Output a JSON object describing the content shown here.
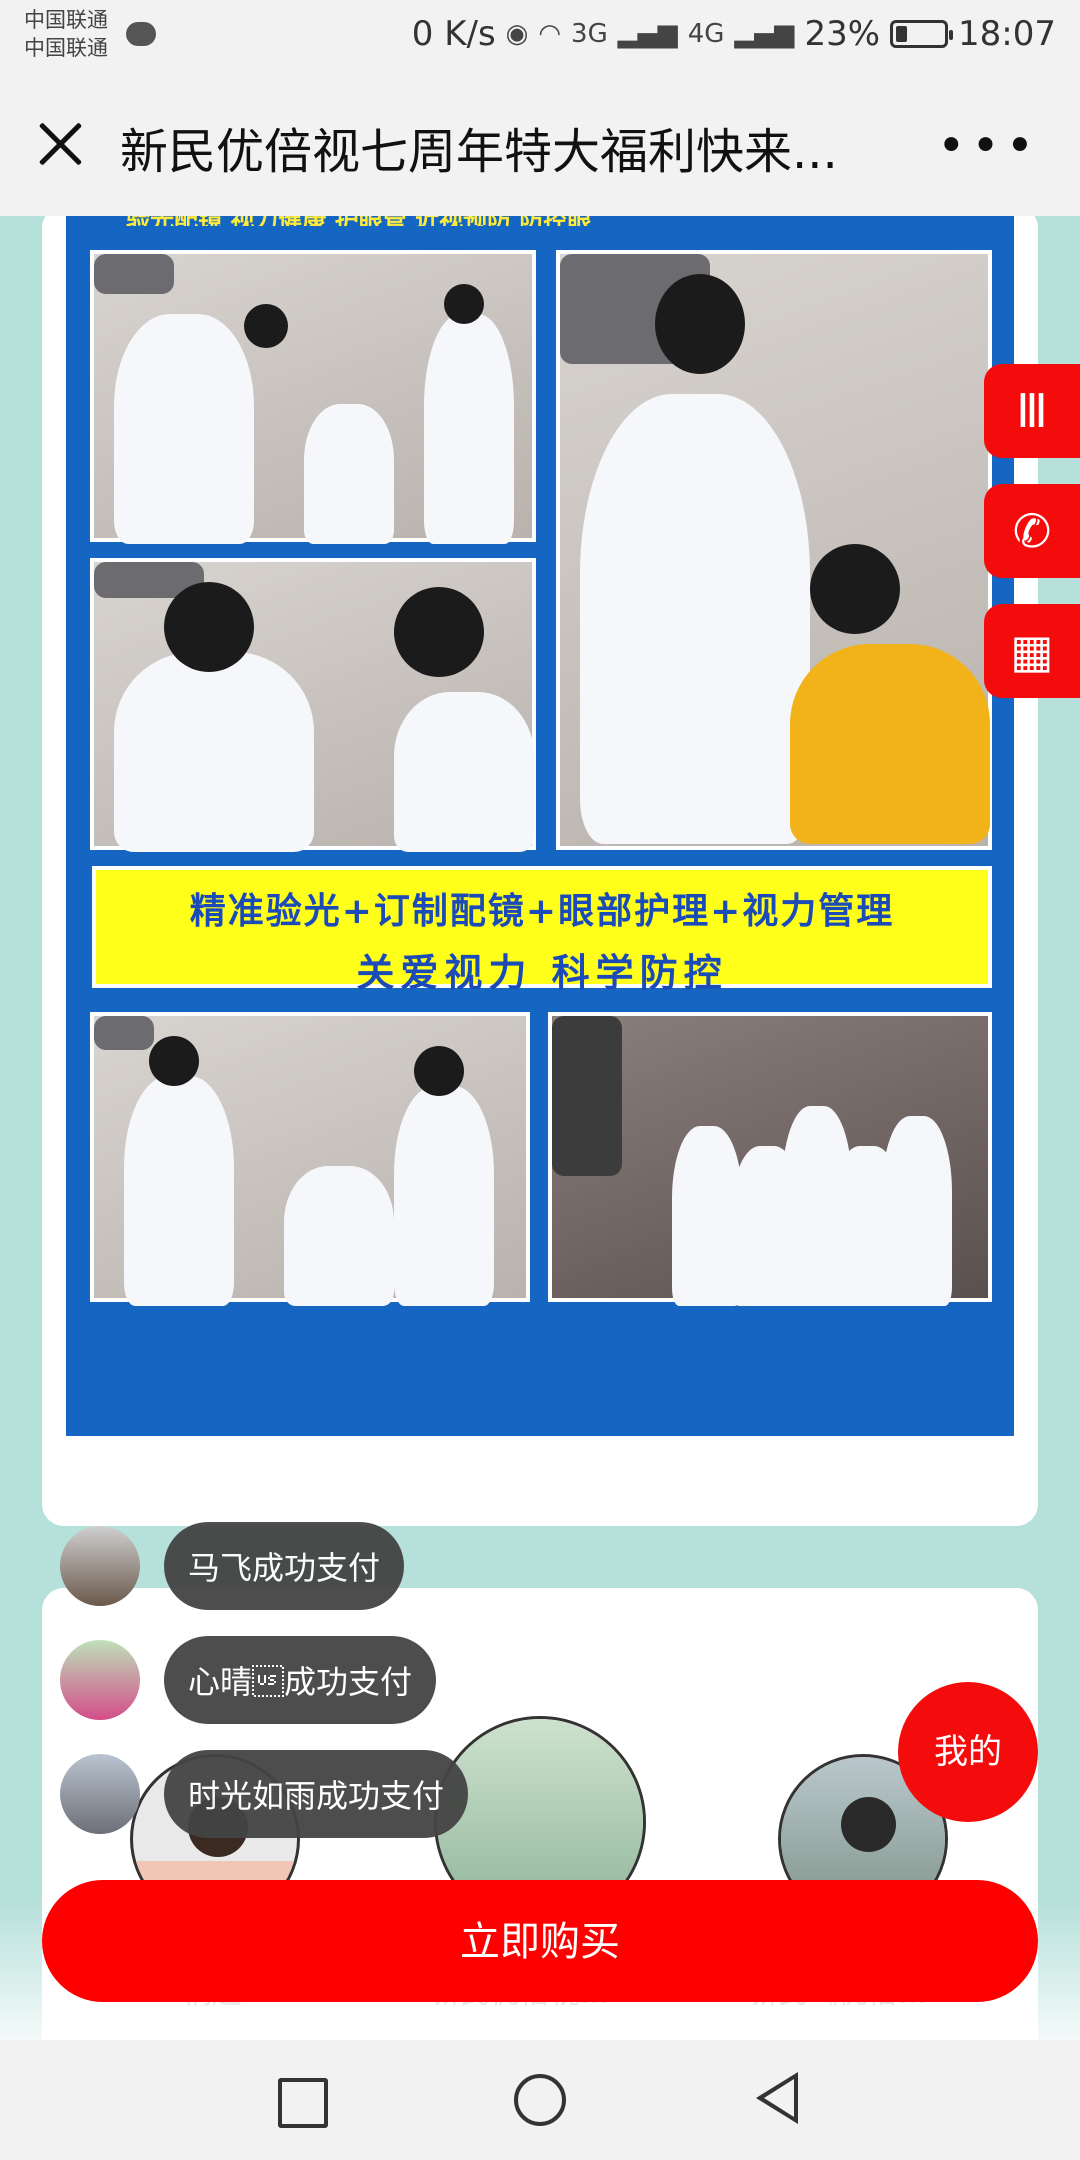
{
  "status_bar": {
    "carrier1": "中国联通",
    "carrier2": "中国联通",
    "speed": "0 K/s",
    "net1": "3G",
    "net2": "4G",
    "battery": "23%",
    "battery_level": 0.23,
    "time": "18:07"
  },
  "navbar": {
    "title": "新民优倍视七周年特大福利快来...",
    "more": "•••"
  },
  "poster": {
    "top_strip": "验光配镜 视力健康 护眼管 近视预防 防控眼",
    "banner_line1": "精准验光+订制配镜+眼部护理+视力管理",
    "banner_line2": "关爱视力   科学防控"
  },
  "notifications": [
    {
      "text": "马飞成功支付"
    },
    {
      "text": "心晴\u001f成功支付"
    },
    {
      "text": "时光如雨成功支付"
    }
  ],
  "under_labels": [
    "桐趣",
    "新民优倍视...",
    "新民《优倍..."
  ],
  "actions": {
    "buy": "立即购买",
    "mine": "我的"
  },
  "colors": {
    "accent_red": "#ff0000",
    "page_bg": "#b6e0da",
    "poster_blue": "#1566c3",
    "banner_yellow": "#ffff1a"
  },
  "icons": {
    "side1": "menu-bars-icon",
    "side2": "phone-icon",
    "side3": "qr-code-icon"
  }
}
